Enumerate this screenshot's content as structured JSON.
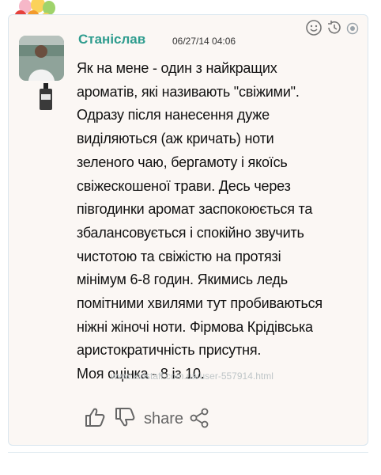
{
  "review": {
    "author": "Станіслав",
    "date": "06/27/14 04:06",
    "lines": [
      "Як на мене - один з найкращих",
      "ароматів, які називають \"свіжими\".",
      "Одразу після нанесення дуже",
      "виділяються (аж кричать) ноти",
      "зеленого чаю, бергамоту і якоїсь",
      "свіжескошеної трави. Десь через",
      "півгодинки аромат заспокоюється та",
      "збалансовується і спокійно звучить",
      "чистотою та свіжістю на протязі",
      "мінімум 6-8 годин. Якимись ледь",
      "помітними хвилями тут пробиваються",
      "ніжні жіночі ноти. Фірмова Крідівська",
      "аристократичність присутня.",
      "Моя оцінка - 8 із 10."
    ],
    "watermark": "www.kidstaff.com.ua/user-557914.html"
  },
  "footer": {
    "share_label": "share"
  },
  "icons": {
    "smile": "smile-icon",
    "history": "history-icon",
    "toggle": "toggle-icon",
    "like": "thumbs-up-icon",
    "dislike": "thumbs-down-icon",
    "share": "share-icon"
  },
  "colors": {
    "author": "#2e9c8e",
    "card_bg": "#fbf7f4",
    "icon_gray": "#777777"
  }
}
